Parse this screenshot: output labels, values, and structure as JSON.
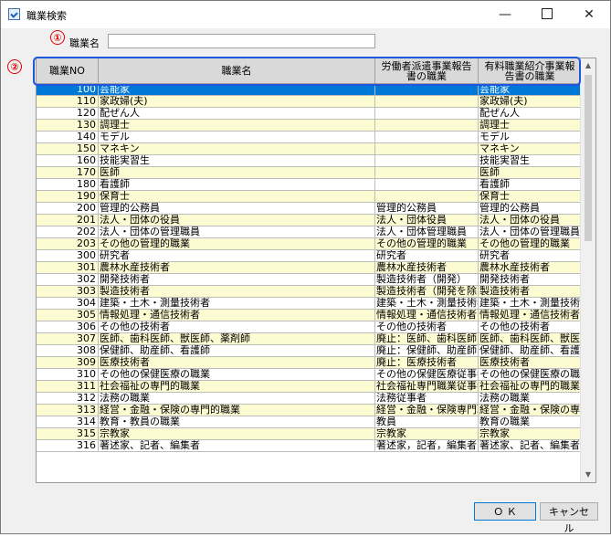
{
  "window": {
    "title": "職業検索",
    "min_glyph": "—",
    "close_glyph": "✕"
  },
  "annotations": {
    "c1": "①",
    "c2": "②"
  },
  "filter": {
    "label": "職業名",
    "value": ""
  },
  "grid": {
    "headers": {
      "no": "職業NO",
      "name": "職業名",
      "dispatch": [
        "労働者派遣事業報告",
        "書の職業"
      ],
      "placement": [
        "有料職業紹介事業報",
        "告書の職業"
      ]
    },
    "rows": [
      {
        "no": "100",
        "name": "芸能家",
        "dispatch": "",
        "placement": "芸能家"
      },
      {
        "no": "110",
        "name": "家政婦(夫)",
        "dispatch": "",
        "placement": "家政婦(夫)"
      },
      {
        "no": "120",
        "name": "配ぜん人",
        "dispatch": "",
        "placement": "配ぜん人"
      },
      {
        "no": "130",
        "name": "調理士",
        "dispatch": "",
        "placement": "調理士"
      },
      {
        "no": "140",
        "name": "モデル",
        "dispatch": "",
        "placement": "モデル"
      },
      {
        "no": "150",
        "name": "マネキン",
        "dispatch": "",
        "placement": "マネキン"
      },
      {
        "no": "160",
        "name": "技能実習生",
        "dispatch": "",
        "placement": "技能実習生"
      },
      {
        "no": "170",
        "name": "医師",
        "dispatch": "",
        "placement": "医師"
      },
      {
        "no": "180",
        "name": "看護師",
        "dispatch": "",
        "placement": "看護師"
      },
      {
        "no": "190",
        "name": "保育士",
        "dispatch": "",
        "placement": "保育士"
      },
      {
        "no": "200",
        "name": "管理的公務員",
        "dispatch": "管理的公務員",
        "placement": "管理的公務員"
      },
      {
        "no": "201",
        "name": "法人・団体の役員",
        "dispatch": "法人・団体役員",
        "placement": "法人・団体の役員"
      },
      {
        "no": "202",
        "name": "法人・団体の管理職員",
        "dispatch": "法人・団体管理職員",
        "placement": "法人・団体の管理職員"
      },
      {
        "no": "203",
        "name": "その他の管理的職業",
        "dispatch": "その他の管理的職業",
        "placement": "その他の管理的職業"
      },
      {
        "no": "300",
        "name": "研究者",
        "dispatch": "研究者",
        "placement": "研究者"
      },
      {
        "no": "301",
        "name": "農林水産技術者",
        "dispatch": "農林水産技術者",
        "placement": "農林水産技術者"
      },
      {
        "no": "302",
        "name": "開発技術者",
        "dispatch": "製造技術者（開発）",
        "placement": "開発技術者"
      },
      {
        "no": "303",
        "name": "製造技術者",
        "dispatch": "製造技術者（開発を除く）",
        "placement": "製造技術者"
      },
      {
        "no": "304",
        "name": "建築・土木・測量技術者",
        "dispatch": "建築・土木・測量技術者",
        "placement": "建築・土木・測量技術者"
      },
      {
        "no": "305",
        "name": "情報処理・通信技術者",
        "dispatch": "情報処理・通信技術者",
        "placement": "情報処理・通信技術者"
      },
      {
        "no": "306",
        "name": "その他の技術者",
        "dispatch": "その他の技術者",
        "placement": "その他の技術者"
      },
      {
        "no": "307",
        "name": "医師、歯科医師、獣医師、薬剤師",
        "dispatch": "廃止：医師、歯科医師",
        "placement": "医師、歯科医師、獣医師"
      },
      {
        "no": "308",
        "name": "保健師、助産師、看護師",
        "dispatch": "廃止：保健師、助産師",
        "placement": "保健師、助産師、看護師"
      },
      {
        "no": "309",
        "name": "医療技術者",
        "dispatch": "廃止：医療技術者",
        "placement": "医療技術者"
      },
      {
        "no": "310",
        "name": "その他の保健医療の職業",
        "dispatch": "その他の保健医療従事者",
        "placement": "その他の保健医療の職業"
      },
      {
        "no": "311",
        "name": "社会福祉の専門的職業",
        "dispatch": "社会福祉専門職業従事者",
        "placement": "社会福祉の専門的職業"
      },
      {
        "no": "312",
        "name": "法務の職業",
        "dispatch": "法務従事者",
        "placement": "法務の職業"
      },
      {
        "no": "313",
        "name": "経営・金融・保険の専門的職業",
        "dispatch": "経営・金融・保険専門職業",
        "placement": "経営・金融・保険の専門的職業"
      },
      {
        "no": "314",
        "name": "教育・教員の職業",
        "dispatch": "教員",
        "placement": "教育の職業"
      },
      {
        "no": "315",
        "name": "宗教家",
        "dispatch": "宗教家",
        "placement": "宗教家"
      },
      {
        "no": "316",
        "name": "著述家、記者、編集者",
        "dispatch": "著述家，記者，編集者",
        "placement": "著述家、記者、編集者"
      }
    ]
  },
  "buttons": {
    "ok": "Ｏ Ｋ",
    "cancel": "キャンセル"
  }
}
